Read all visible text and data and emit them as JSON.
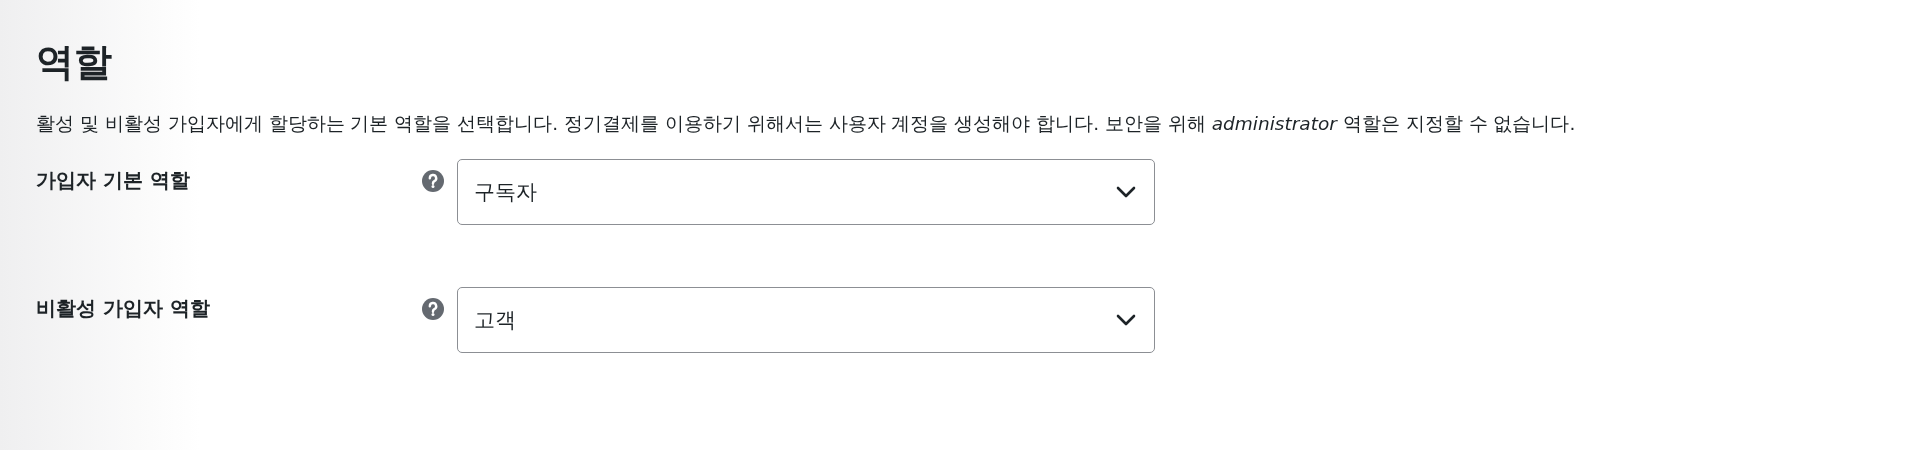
{
  "section": {
    "title": "역할",
    "description": "활성 및 비활성 가입자에게 할당하는 기본 역할을 선택합니다. 정기결제를 이용하기 위해서는 사용자 계정을 생성해야 합니다. 보안을 위해 *administrator* 역할은 지정할 수 없습니다."
  },
  "fields": [
    {
      "label": "가입자 기본 역할",
      "value": "구독자"
    },
    {
      "label": "비활성 가입자 역할",
      "value": "고객"
    }
  ]
}
